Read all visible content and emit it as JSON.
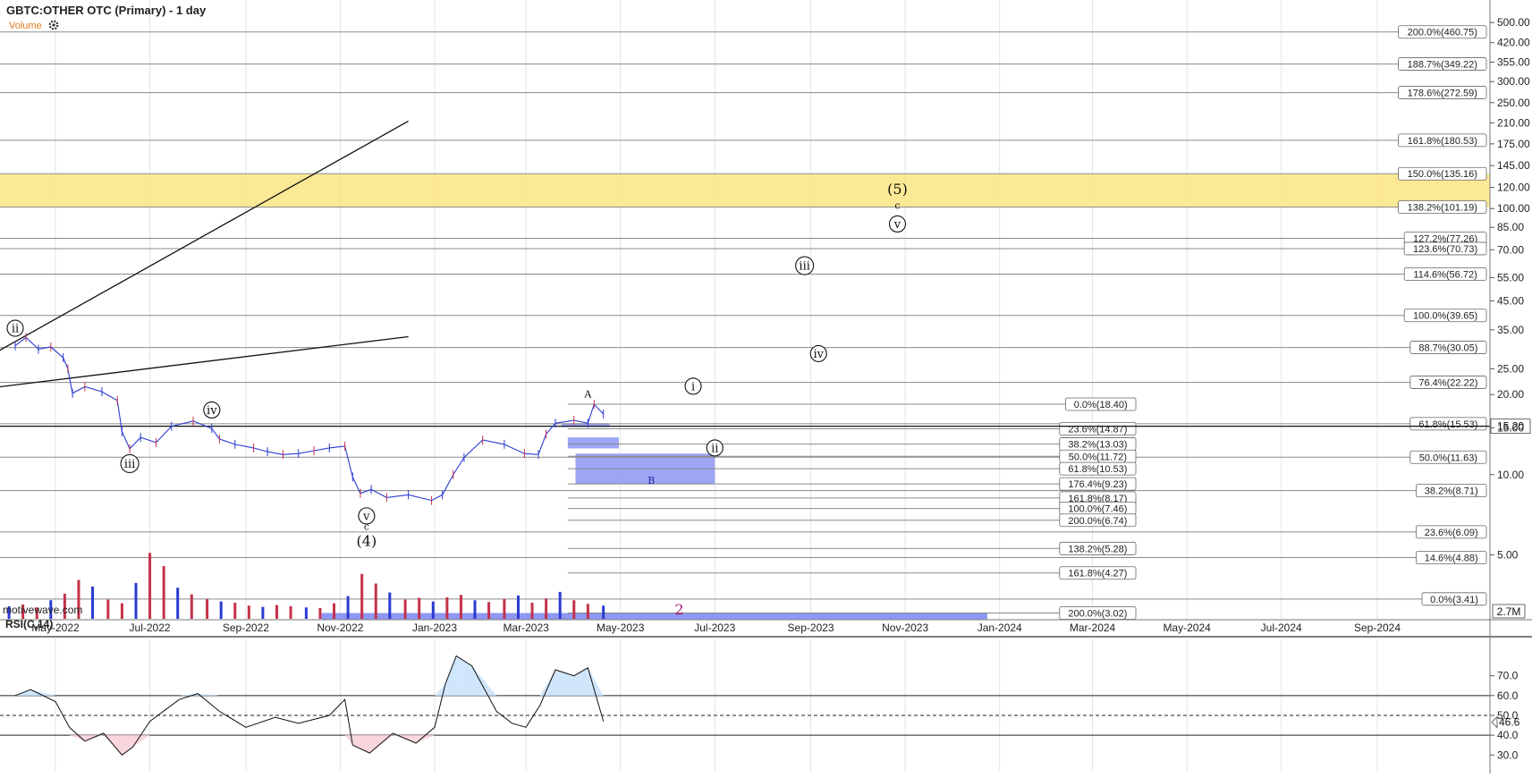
{
  "header": {
    "symbol": "GBTC:OTHER OTC (Primary) - 1 day",
    "volume_label": "Volume",
    "settings_icon": "gear-icon"
  },
  "watermark": "motivewave.com",
  "colors": {
    "fib_zone": "#fbe37a",
    "blue_box": "#8c95f2",
    "wave2_label": "#9c1d6b",
    "rsi_high_fill": "#cfe6fb",
    "rsi_low_fill": "#f8d6dc",
    "price_label_bg": "#ffffff"
  },
  "chart_data": [
    {
      "type": "line",
      "title": "GBTC:OTHER OTC (Primary) - 1 day",
      "scale": "log",
      "x_tick_labels": [
        "May-2022",
        "Jul-2022",
        "Sep-2022",
        "Nov-2022",
        "Jan-2023",
        "Mar-2023",
        "May-2023",
        "Jul-2023",
        "Sep-2023",
        "Nov-2023",
        "Jan-2024",
        "Mar-2024",
        "May-2024",
        "Jul-2024",
        "Sep-2024"
      ],
      "y_tick_labels": [
        "500.00",
        "420.00",
        "355.00",
        "300.00",
        "250.00",
        "210.00",
        "175.00",
        "145.00",
        "120.00",
        "100.00",
        "85.00",
        "70.00",
        "55.00",
        "45.00",
        "35.00",
        "25.00",
        "20.00",
        "15.00",
        "10.00",
        "5.00"
      ],
      "ylim": [
        2.85,
        580
      ],
      "current_price": "15.20",
      "volume_label": "2.7M",
      "price_series": {
        "x": [
          "2022-04-05",
          "2022-04-12",
          "2022-04-20",
          "2022-04-28",
          "2022-05-06",
          "2022-05-09",
          "2022-05-12",
          "2022-05-20",
          "2022-05-31",
          "2022-06-10",
          "2022-06-13",
          "2022-06-18",
          "2022-06-25",
          "2022-07-05",
          "2022-07-15",
          "2022-07-29",
          "2022-08-10",
          "2022-08-15",
          "2022-08-25",
          "2022-09-06",
          "2022-09-15",
          "2022-09-25",
          "2022-10-05",
          "2022-10-15",
          "2022-10-25",
          "2022-11-04",
          "2022-11-09",
          "2022-11-14",
          "2022-11-21",
          "2022-12-01",
          "2022-12-15",
          "2022-12-30",
          "2023-01-06",
          "2023-01-13",
          "2023-01-20",
          "2023-02-01",
          "2023-02-15",
          "2023-02-28",
          "2023-03-09",
          "2023-03-14",
          "2023-03-20",
          "2023-04-01",
          "2023-04-10",
          "2023-04-14",
          "2023-04-20"
        ],
        "y": [
          30.5,
          32.8,
          29.6,
          30.2,
          27.5,
          25.0,
          20.2,
          21.4,
          20.5,
          19.0,
          14.5,
          12.5,
          13.8,
          13.2,
          15.2,
          15.9,
          14.9,
          13.6,
          13.0,
          12.6,
          12.2,
          11.9,
          12.0,
          12.3,
          12.6,
          12.8,
          9.8,
          8.5,
          8.8,
          8.2,
          8.4,
          8.0,
          8.4,
          10.0,
          11.6,
          13.5,
          13.0,
          12.0,
          11.9,
          14.2,
          15.6,
          16.0,
          15.6,
          18.4,
          16.9
        ]
      },
      "count_labels": [
        {
          "text": "ii",
          "date": "2022-04-05",
          "price": 35.5,
          "style": "circle"
        },
        {
          "text": "iii",
          "date": "2022-06-18",
          "price": 11.0,
          "style": "circle"
        },
        {
          "text": "iv",
          "date": "2022-08-10",
          "price": 17.5,
          "style": "circle"
        },
        {
          "text": "v",
          "date": "2022-11-18",
          "price": 7.0,
          "style": "circle"
        },
        {
          "text": "c",
          "date": "2022-11-18",
          "price": 6.45,
          "style": "plain-small"
        },
        {
          "text": "(4)",
          "date": "2022-11-18",
          "price": 5.6,
          "style": "plain"
        },
        {
          "text": "A",
          "date": "2023-04-10",
          "price": 20.3,
          "style": "plain-small"
        },
        {
          "text": "i",
          "date": "2023-06-17",
          "price": 21.5,
          "style": "circle"
        },
        {
          "text": "ii",
          "date": "2023-07-01",
          "price": 12.6,
          "style": "circle"
        },
        {
          "text": "B",
          "date": "2023-05-21",
          "price": 9.6,
          "style": "plain-small-blue"
        },
        {
          "text": "iii",
          "date": "2023-08-28",
          "price": 61.0,
          "style": "circle"
        },
        {
          "text": "iv",
          "date": "2023-09-06",
          "price": 28.5,
          "style": "circle"
        },
        {
          "text": "(5)",
          "date": "2023-10-27",
          "price": 118.0,
          "style": "plain"
        },
        {
          "text": "c",
          "date": "2023-10-27",
          "price": 103.5,
          "style": "plain-small"
        },
        {
          "text": "v",
          "date": "2023-10-27",
          "price": 87.5,
          "style": "circle"
        },
        {
          "text": "2",
          "date": "2023-06-08",
          "price": 3.1,
          "style": "plain-purple"
        }
      ],
      "fib_right": [
        {
          "label": "200.0%(460.75)",
          "price": 460.75
        },
        {
          "label": "188.7%(349.22)",
          "price": 349.22
        },
        {
          "label": "178.6%(272.59)",
          "price": 272.59
        },
        {
          "label": "161.8%(180.53)",
          "price": 180.53
        },
        {
          "label": "150.0%(135.16)",
          "price": 135.16
        },
        {
          "label": "138.2%(101.19)",
          "price": 101.19
        },
        {
          "label": "127.2%(77.26)",
          "price": 77.26
        },
        {
          "label": "123.6%(70.73)",
          "price": 70.73
        },
        {
          "label": "114.6%(56.72)",
          "price": 56.72
        },
        {
          "label": "100.0%(39.65)",
          "price": 39.65
        },
        {
          "label": "88.7%(30.05)",
          "price": 30.05
        },
        {
          "label": "76.4%(22.22)",
          "price": 22.22
        },
        {
          "label": "61.8%(15.53)",
          "price": 15.53
        },
        {
          "label": "50.0%(11.63)",
          "price": 11.63
        },
        {
          "label": "38.2%(8.71)",
          "price": 8.71
        },
        {
          "label": "23.6%(6.09)",
          "price": 6.09
        },
        {
          "label": "14.6%(4.88)",
          "price": 4.88
        },
        {
          "label": "0.0%(3.41)",
          "price": 3.41
        }
      ],
      "fib_mid": [
        {
          "label": "0.0%(18.40)",
          "price": 18.4
        },
        {
          "label": "23.6%(14.87)",
          "price": 14.87
        },
        {
          "label": "38.2%(13.03)",
          "price": 13.03
        },
        {
          "label": "50.0%(11.72)",
          "price": 11.72
        },
        {
          "label": "61.8%(10.53)",
          "price": 10.53
        },
        {
          "label": "176.4%(9.23)",
          "price": 9.23
        },
        {
          "label": "161.8%(8.17)",
          "price": 8.17
        },
        {
          "label": "100.0%(7.46)",
          "price": 7.46
        },
        {
          "label": "200.0%(6.74)",
          "price": 6.74
        },
        {
          "label": "138.2%(5.28)",
          "price": 5.28
        },
        {
          "label": "161.8%(4.27)",
          "price": 4.27
        },
        {
          "label": "200.0%(3.02)",
          "price": 3.02
        }
      ],
      "fib_zone": {
        "from": 101.19,
        "to": 135.16
      },
      "blue_boxes": [
        {
          "from_date": "2023-03-24",
          "to_date": "2023-04-24",
          "from": 15.1,
          "to": 15.6
        },
        {
          "from_date": "2023-03-28",
          "to_date": "2023-04-30",
          "from": 12.55,
          "to": 13.8
        },
        {
          "from_date": "2023-04-02",
          "to_date": "2023-07-01",
          "from": 9.2,
          "to": 12.0
        },
        {
          "from_date": "2022-10-20",
          "to_date": "2023-12-24",
          "from": 2.85,
          "to": 3.02
        }
      ],
      "channel_lines": [
        {
          "from_date": "2022-03-15",
          "from": 27.0,
          "to_date": "2022-12-15",
          "to": 213.0
        },
        {
          "from_date": "2022-03-15",
          "from": 21.0,
          "to_date": "2022-12-15",
          "to": 33.0
        }
      ],
      "volume_millions": [
        2.1,
        2.4,
        1.9,
        3.1,
        4.2,
        6.5,
        5.4,
        3.2,
        2.6,
        6.0,
        11.0,
        8.8,
        5.2,
        4.1,
        3.3,
        2.9,
        2.7,
        2.2,
        2.0,
        2.3,
        2.1,
        1.9,
        1.8,
        2.6,
        3.8,
        7.5,
        5.9,
        4.4,
        3.2,
        3.5,
        2.9,
        3.6,
        4.0,
        3.1,
        2.8,
        3.3,
        3.9,
        2.7,
        3.4,
        4.5,
        3.1,
        2.5,
        2.2
      ]
    },
    {
      "type": "line",
      "title": "RSI(C,14)",
      "y_tick_labels": [
        "70.0",
        "60.0",
        "50.0",
        "40.0",
        "30.0"
      ],
      "ylim": [
        22,
        87
      ],
      "reference_lines": [
        60,
        50,
        40
      ],
      "current_value": "46.6",
      "x": [
        "2022-04-05",
        "2022-04-15",
        "2022-05-01",
        "2022-05-10",
        "2022-05-20",
        "2022-06-01",
        "2022-06-13",
        "2022-06-20",
        "2022-07-01",
        "2022-07-20",
        "2022-08-01",
        "2022-08-15",
        "2022-09-01",
        "2022-09-20",
        "2022-10-05",
        "2022-10-25",
        "2022-11-04",
        "2022-11-09",
        "2022-11-20",
        "2022-12-05",
        "2022-12-20",
        "2023-01-01",
        "2023-01-08",
        "2023-01-15",
        "2023-01-25",
        "2023-02-10",
        "2023-02-20",
        "2023-03-01",
        "2023-03-10",
        "2023-03-20",
        "2023-04-01",
        "2023-04-10",
        "2023-04-20"
      ],
      "values": [
        60,
        63,
        57,
        44,
        37,
        41,
        30,
        34,
        47,
        58,
        61,
        52,
        44,
        49,
        46,
        50,
        58,
        35,
        31,
        41,
        36,
        44,
        66,
        80,
        75,
        52,
        46,
        44,
        55,
        73,
        70,
        74,
        47
      ]
    }
  ]
}
